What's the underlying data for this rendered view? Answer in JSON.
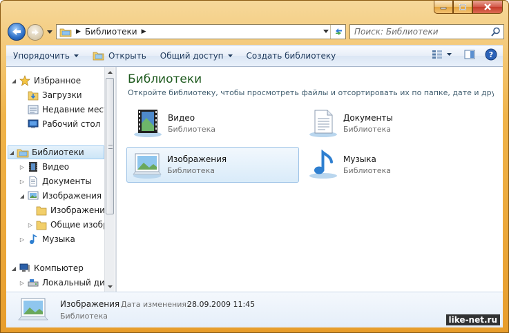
{
  "window": {
    "caption_buttons": [
      "minimize",
      "maximize",
      "close"
    ]
  },
  "nav": {
    "breadcrumb": "Библиотеки",
    "search_placeholder": "Поиск: Библиотеки"
  },
  "toolbar": {
    "organize": "Упорядочить",
    "open": "Открыть",
    "share": "Общий доступ",
    "new_library": "Создать библиотеку"
  },
  "sidebar": {
    "favorites": "Избранное",
    "downloads": "Загрузки",
    "recent": "Недавние места",
    "desktop": "Рабочий стол",
    "libraries": "Библиотеки",
    "video": "Видео",
    "documents": "Документы",
    "pictures": "Изображения",
    "pictures_sub": "Изображения",
    "public_pictures": "Общие изобра",
    "music": "Музыка",
    "computer": "Компьютер",
    "local_disk": "Локальный диск"
  },
  "main": {
    "title": "Библиотеки",
    "subtitle": "Откройте библиотеку, чтобы просмотреть файлы и отсортировать их по папке, дате и друг...",
    "libraries": [
      {
        "name": "Видео",
        "kind": "Библиотека",
        "icon": "video-library-icon"
      },
      {
        "name": "Документы",
        "kind": "Библиотека",
        "icon": "documents-library-icon"
      },
      {
        "name": "Изображения",
        "kind": "Библиотека",
        "icon": "pictures-library-icon"
      },
      {
        "name": "Музыка",
        "kind": "Библиотека",
        "icon": "music-library-icon"
      }
    ]
  },
  "details": {
    "name": "Изображения",
    "date_label": "Дата изменения:",
    "date_value": "28.09.2009 11:45",
    "kind": "Библиотека"
  },
  "watermark": "like-net.ru",
  "colors": {
    "frame": "#e79d2c",
    "title_green": "#1e5a1e",
    "toolbar_text": "#1e395b",
    "selection": "#cde6f7"
  }
}
